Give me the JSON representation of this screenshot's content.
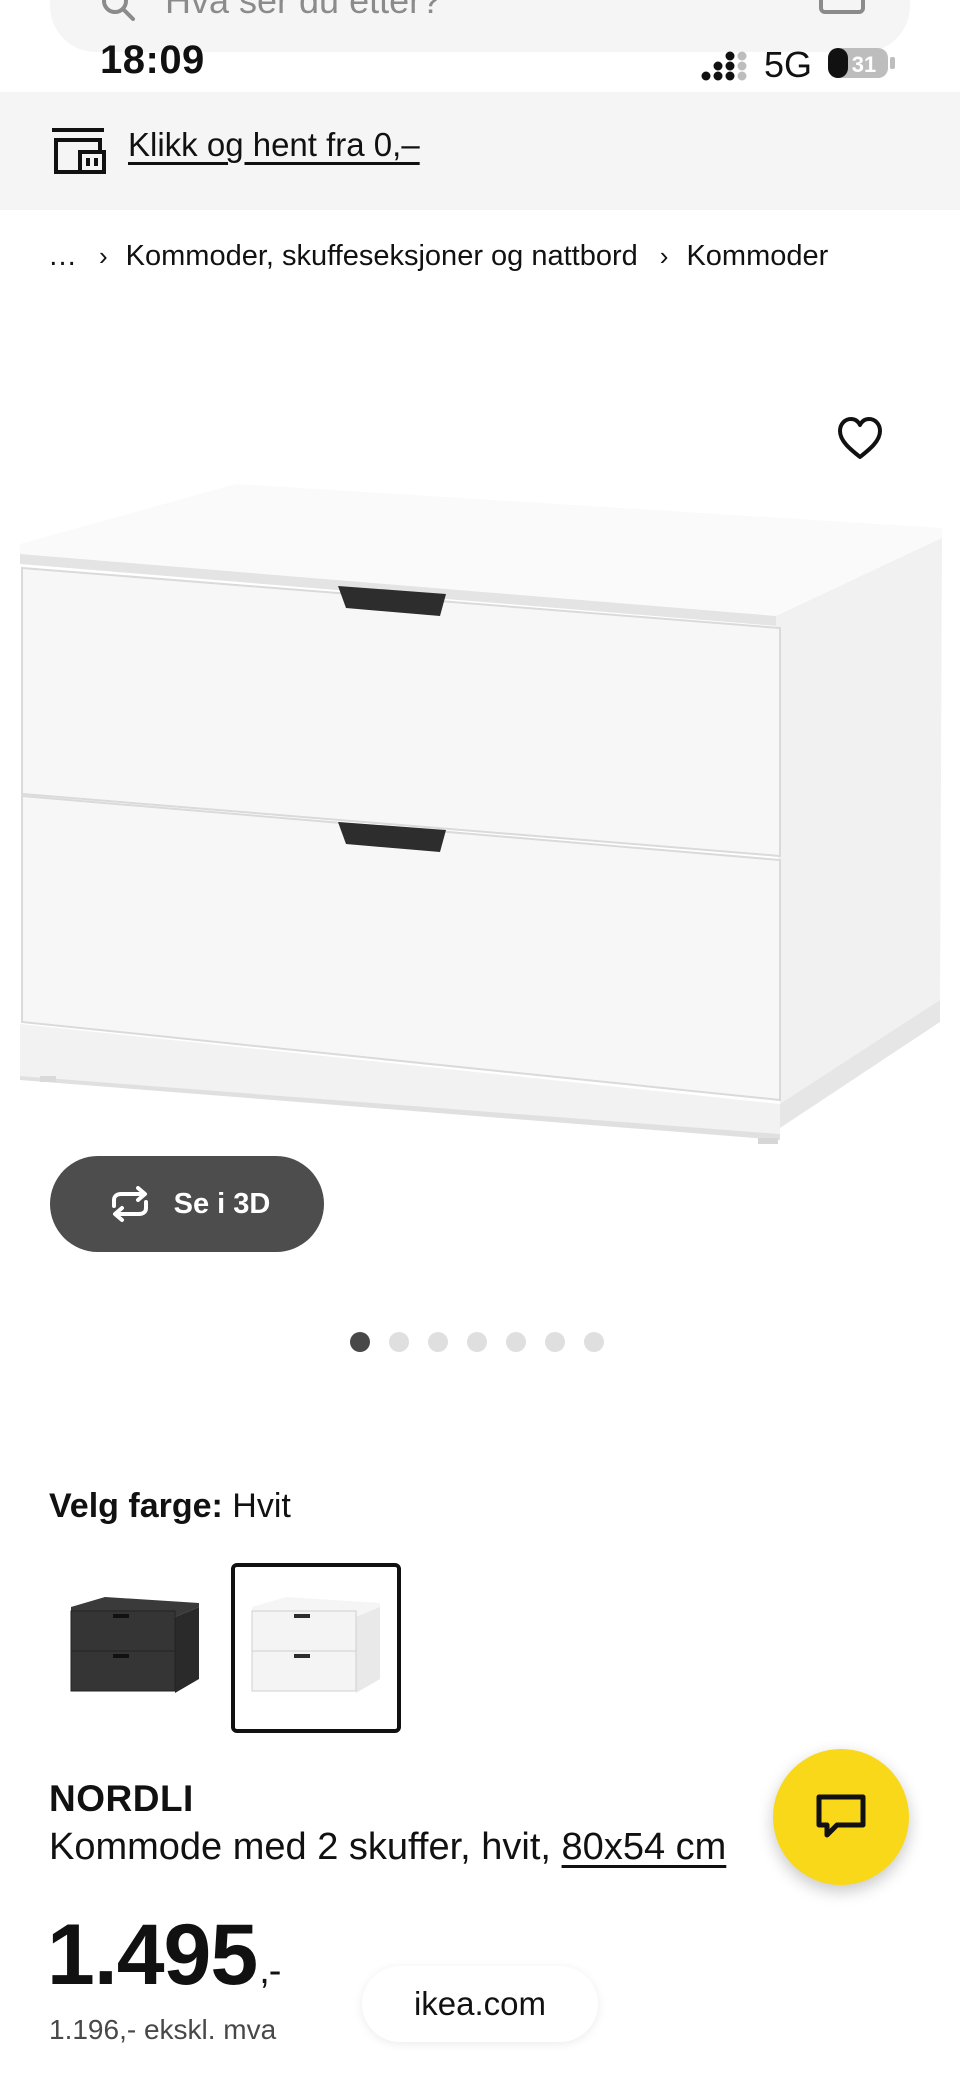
{
  "search": {
    "placeholder": "Hva ser du etter?"
  },
  "status_bar": {
    "time": "18:09",
    "network": "5G",
    "battery_level": "31"
  },
  "banner": {
    "link_text": "Klikk og hent fra 0,–",
    "icon": "store-pickup-icon"
  },
  "breadcrumb": {
    "ellipsis": "…",
    "items": [
      "Kommoder, skuffeseksjoner og nattbord",
      "Kommoder"
    ]
  },
  "gallery": {
    "view3d_label": "Se i 3D",
    "image_count": 7,
    "current_index": 1
  },
  "color_select": {
    "label": "Velg farge:",
    "value": "Hvit",
    "options": [
      "Svart",
      "Hvit"
    ],
    "selected": "Hvit"
  },
  "product": {
    "name": "NORDLI",
    "description": "Kommode med 2 skuffer, hvit, ",
    "size_link": "80x54 cm",
    "price_main": "1.495",
    "price_suffix": ",-",
    "price_ex_vat": "1.196,- ekskl. mva"
  },
  "browser": {
    "url": "ikea.com"
  },
  "colors": {
    "accent_yellow": "#f9d719",
    "button_dark": "#4d4d4d",
    "banner_bg": "#f5f5f5"
  }
}
